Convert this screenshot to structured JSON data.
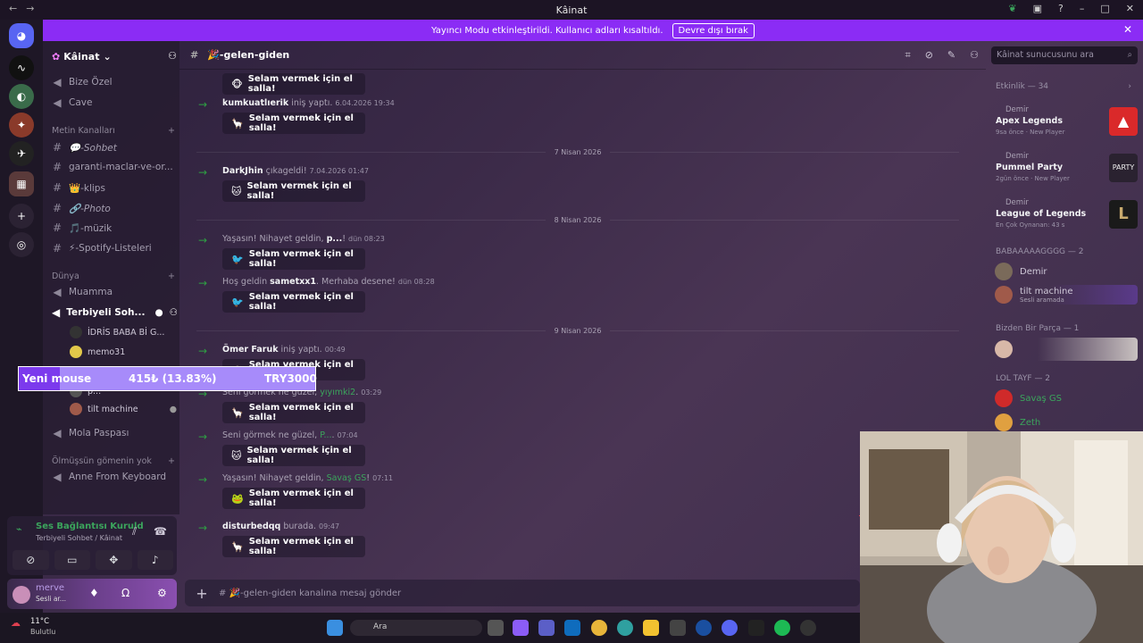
{
  "titlebar": {
    "title": "Kâinat",
    "back": "←",
    "forward": "→"
  },
  "banner": {
    "text": "Yayıncı Modu etkinleştirildi. Kullanıcı adları kısaltıldı.",
    "button": "Devre dışı bırak"
  },
  "server": {
    "name": "Kâinat",
    "channels_top": [
      "Bize Özel",
      "Cave"
    ],
    "cat_text": "Metin Kanalları",
    "text_channels": [
      "💬-Sohbet",
      "garanti-maclar-ve-or...",
      "👑-klips",
      "🔗-Photo",
      "🎵-müzik",
      "⚡-Spotify-Listeleri"
    ],
    "cat_dunya": "Dünya",
    "dunya_channels": [
      "Muamma",
      "Terbiyeli Soh..."
    ],
    "voice_users": [
      "İDRİS BABA Bİ G...",
      "memo31",
      "p...",
      "tilt machine"
    ],
    "after_voice": "Mola Paspası",
    "cat_olm": "Ölmüşsün gömenin yok",
    "olm_channels": [
      "Anne From Keyboard"
    ]
  },
  "voice": {
    "status": "Ses Bağlantısı Kuruld",
    "where": "Terbiyeli Sohbet / Kâinat"
  },
  "user": {
    "name": "merve",
    "status": "Sesli ar..."
  },
  "chat": {
    "channel": "🎉-gelen-giden",
    "wave_label": "Selam vermek için el salla!",
    "input_placeholder": "# 🎉-gelen-giden kanalına mesaj gönder",
    "dates": [
      "7 Nisan 2026",
      "8 Nisan 2026",
      "9 Nisan 2026"
    ],
    "messages": [
      {
        "pre": "",
        "user": "",
        "post": "",
        "ts": ""
      },
      {
        "pre": "",
        "user": "kumkuatlıerik",
        "post": " iniş yaptı.",
        "ts": "6.04.2026 19:34"
      },
      {
        "pre": "",
        "user": "DarkJhin",
        "post": " çıkageldi!",
        "ts": "7.04.2026 01:47"
      },
      {
        "pre": "Yaşasın! Nihayet geldin, ",
        "user": "p...",
        "post": "!",
        "ts": "dün 08:23"
      },
      {
        "pre": "Hoş geldin ",
        "user": "sametxx1",
        "post": ". Merhaba desene!",
        "ts": "dün 08:28"
      },
      {
        "pre": "",
        "user": "Ömer Faruk",
        "post": " iniş yaptı.",
        "ts": "00:49"
      },
      {
        "pre": "Seni görmek ne güzel, ",
        "user": "yıyımki2",
        "post": ".",
        "ts": "03:29"
      },
      {
        "pre": "Seni görmek ne güzel, ",
        "user": "P...",
        "post": ".",
        "ts": "07:04"
      },
      {
        "pre": "Yaşasın! Nihayet geldin, ",
        "user": "Savaş GS",
        "post": "!",
        "ts": "07:11"
      },
      {
        "pre": "",
        "user": "disturbedqq",
        "post": " burada.",
        "ts": "09:47"
      }
    ]
  },
  "search": {
    "placeholder": "Kâinat sunucusunu ara"
  },
  "members": {
    "activity_header": "Etkinlik — 34",
    "activities": [
      {
        "who": "Demir",
        "game": "Apex Legends",
        "meta": "9sa önce · New Player",
        "color": "#da292a"
      },
      {
        "who": "Demir",
        "game": "Pummel Party",
        "meta": "2gün önce · New Player",
        "color": "#2a2230"
      },
      {
        "who": "Demir",
        "game": "League of Legends",
        "meta": "En Çok Oynanan: 43 s",
        "color": "#c8aa6e"
      }
    ],
    "group1": "BABAAAAAGGGG — 2",
    "group1_members": [
      "Demir",
      "tilt machine"
    ],
    "tilt_status": "Sesli aramada",
    "group2": "Bizden Bir Parça — 1",
    "group3": "LOL TAYF — 2",
    "group3_members": [
      "Savaş GS",
      "Zeth"
    ]
  },
  "overlay": {
    "label": "Yeni mouse",
    "amount": "415₺ (13.83%)",
    "goal": "TRY3000",
    "progress": 0.1383
  },
  "taskbar": {
    "weather_temp": "11°C",
    "weather_desc": "Bulutlu",
    "search": "Ara"
  }
}
